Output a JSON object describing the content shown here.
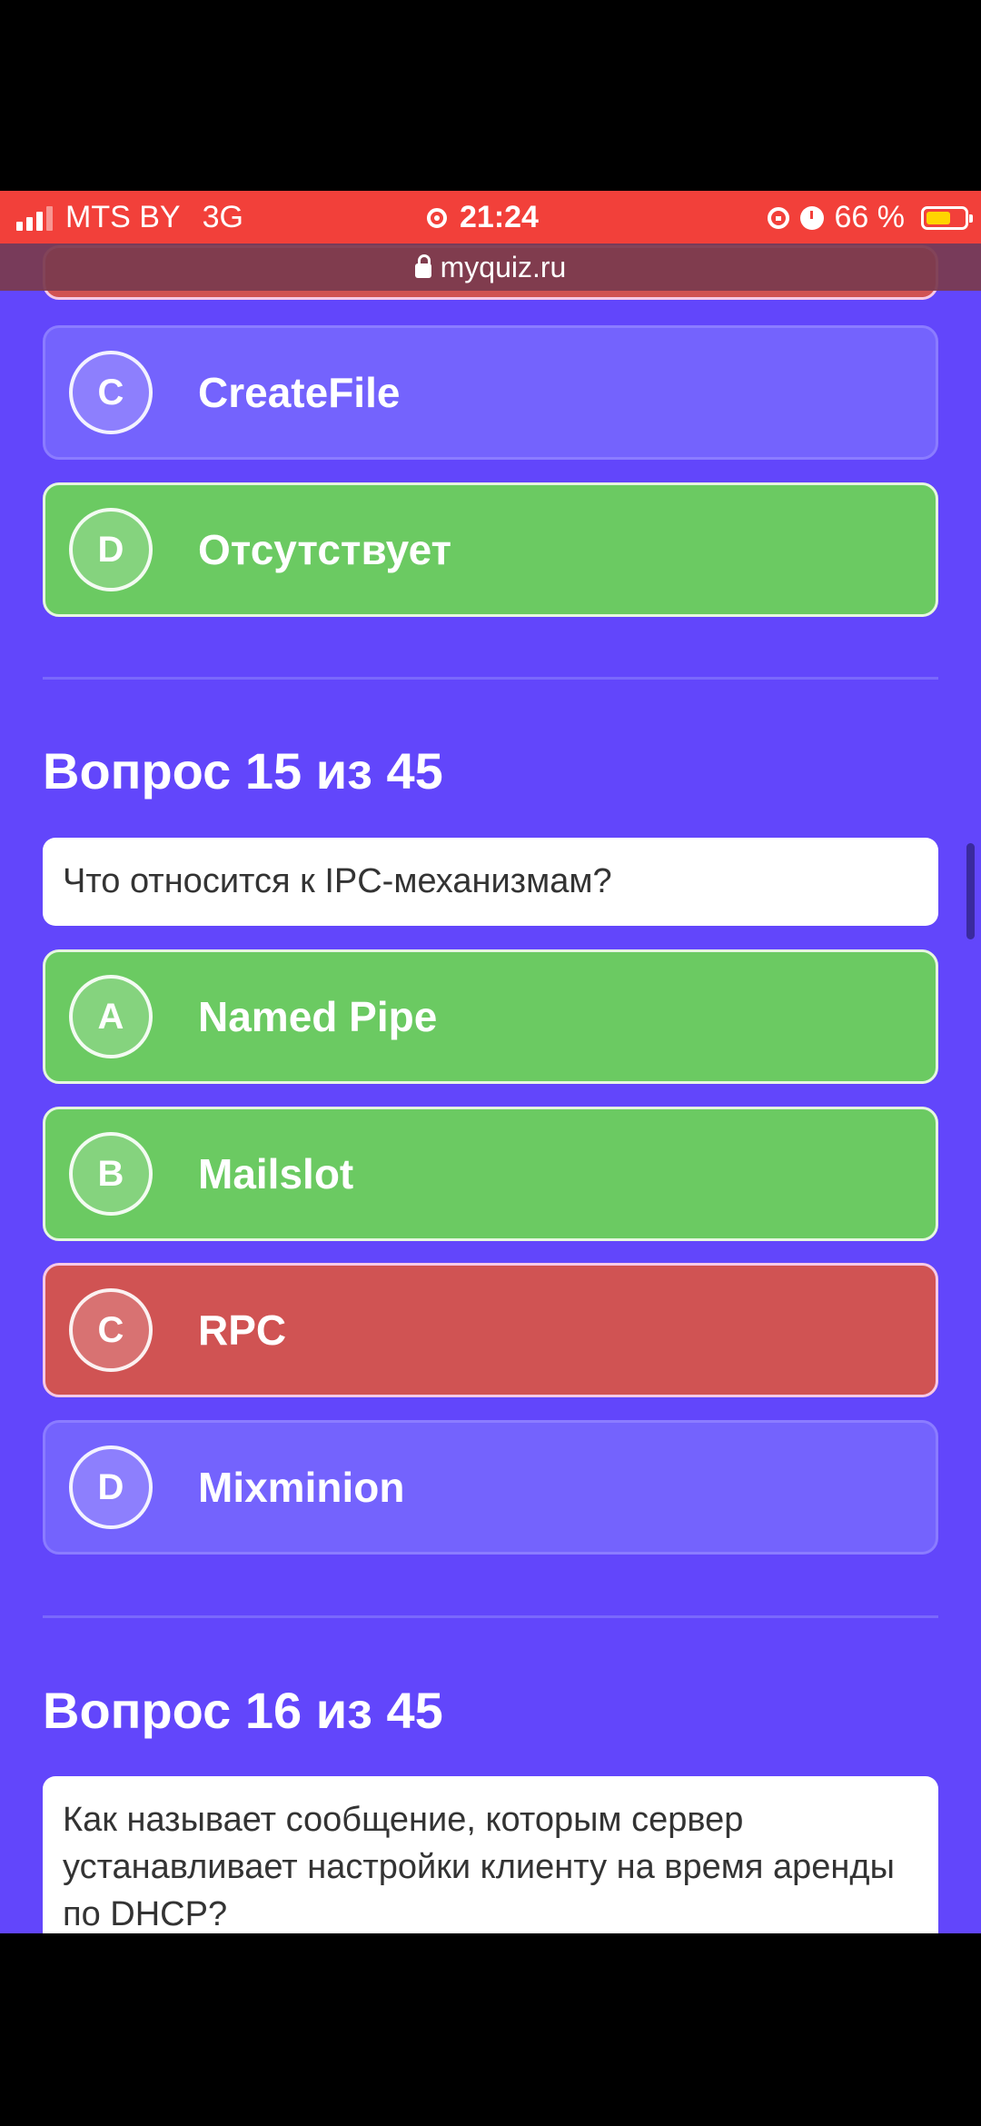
{
  "status_bar": {
    "carrier": "MTS BY",
    "network": "3G",
    "time": "21:24",
    "battery_percent": "66 %",
    "battery_level": 0.66
  },
  "url_bar": {
    "url": "myquiz.ru"
  },
  "question_14": {
    "options": [
      {
        "letter": "C",
        "text": "CreateFile",
        "state": "neutral"
      },
      {
        "letter": "D",
        "text": "Отсутствует",
        "state": "correct"
      }
    ]
  },
  "question_15": {
    "title": "Вопрос 15 из 45",
    "text": "Что относится к IPC-механизмам?",
    "options": [
      {
        "letter": "A",
        "text": "Named Pipe",
        "state": "correct"
      },
      {
        "letter": "B",
        "text": "Mailslot",
        "state": "correct"
      },
      {
        "letter": "C",
        "text": "RPC",
        "state": "wrong"
      },
      {
        "letter": "D",
        "text": "Mixminion",
        "state": "neutral"
      }
    ]
  },
  "question_16": {
    "title": "Вопрос 16 из 45",
    "text": "Как называет сообщение, которым сервер устанавливает настройки клиенту на время аренды по DHCP?"
  },
  "colors": {
    "background": "#6246fb",
    "correct": "#6bca62",
    "wrong": "#d05353",
    "neutral": "#7463fd",
    "status_bar": "#f2403a"
  }
}
